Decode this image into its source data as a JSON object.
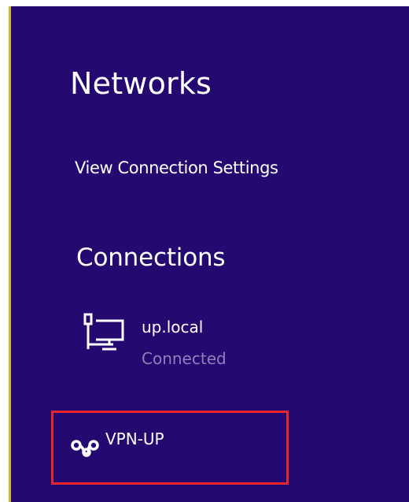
{
  "networks_pane": {
    "title": "Networks",
    "view_settings_label": "View Connection Settings",
    "connections_heading": "Connections",
    "connections": [
      {
        "name": "up.local",
        "status": "Connected",
        "icon": "ethernet-icon"
      },
      {
        "name": "VPN-UP",
        "icon": "vpn-icon",
        "highlighted": true
      }
    ]
  },
  "colors": {
    "background": "#240a70",
    "text": "#ffffff",
    "status_text": "#8d80bd",
    "highlight_border": "#e8252b",
    "left_edge": "#d4b630"
  }
}
